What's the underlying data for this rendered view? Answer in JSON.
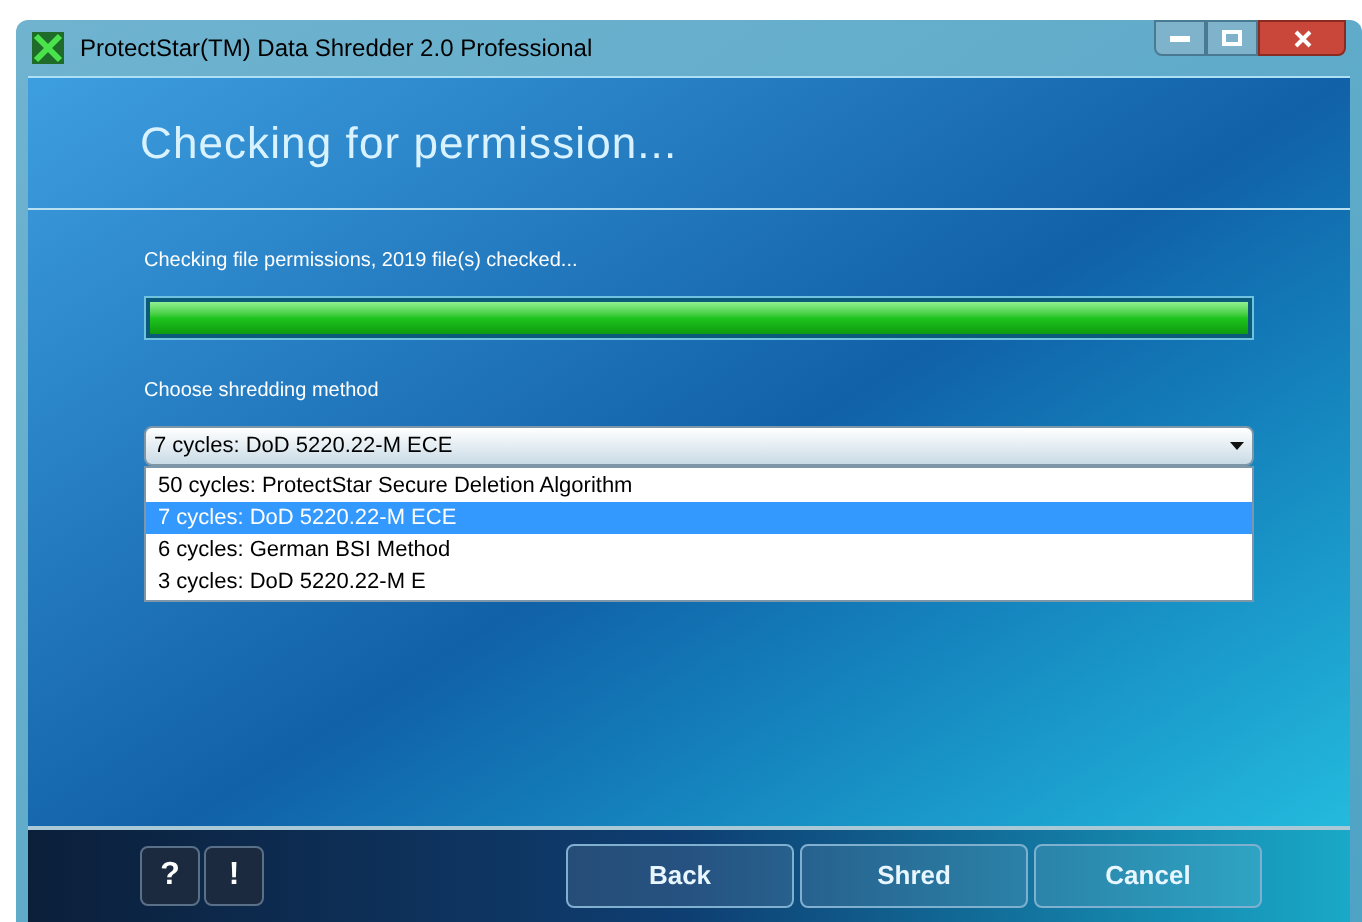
{
  "window": {
    "title": "ProtectStar(TM) Data Shredder 2.0 Professional"
  },
  "heading": "Checking for permission...",
  "status": "Checking file permissions, 2019 file(s) checked...",
  "progress": {
    "level": 1
  },
  "method": {
    "label": "Choose shredding method",
    "value": "7 cycles: DoD 5220.22-M ECE",
    "expanded": true,
    "options": [
      {
        "label": "50 cycles: ProtectStar Secure Deletion Algorithm",
        "selected": false
      },
      {
        "label": "7 cycles: DoD 5220.22-M ECE",
        "selected": true
      },
      {
        "label": "6 cycles: German BSI Method",
        "selected": false
      },
      {
        "label": "3 cycles: DoD 5220.22-M E",
        "selected": false
      }
    ]
  },
  "help_buttons": [
    "?",
    "!"
  ],
  "buttons": [
    "Back",
    "Shred",
    "Cancel"
  ]
}
